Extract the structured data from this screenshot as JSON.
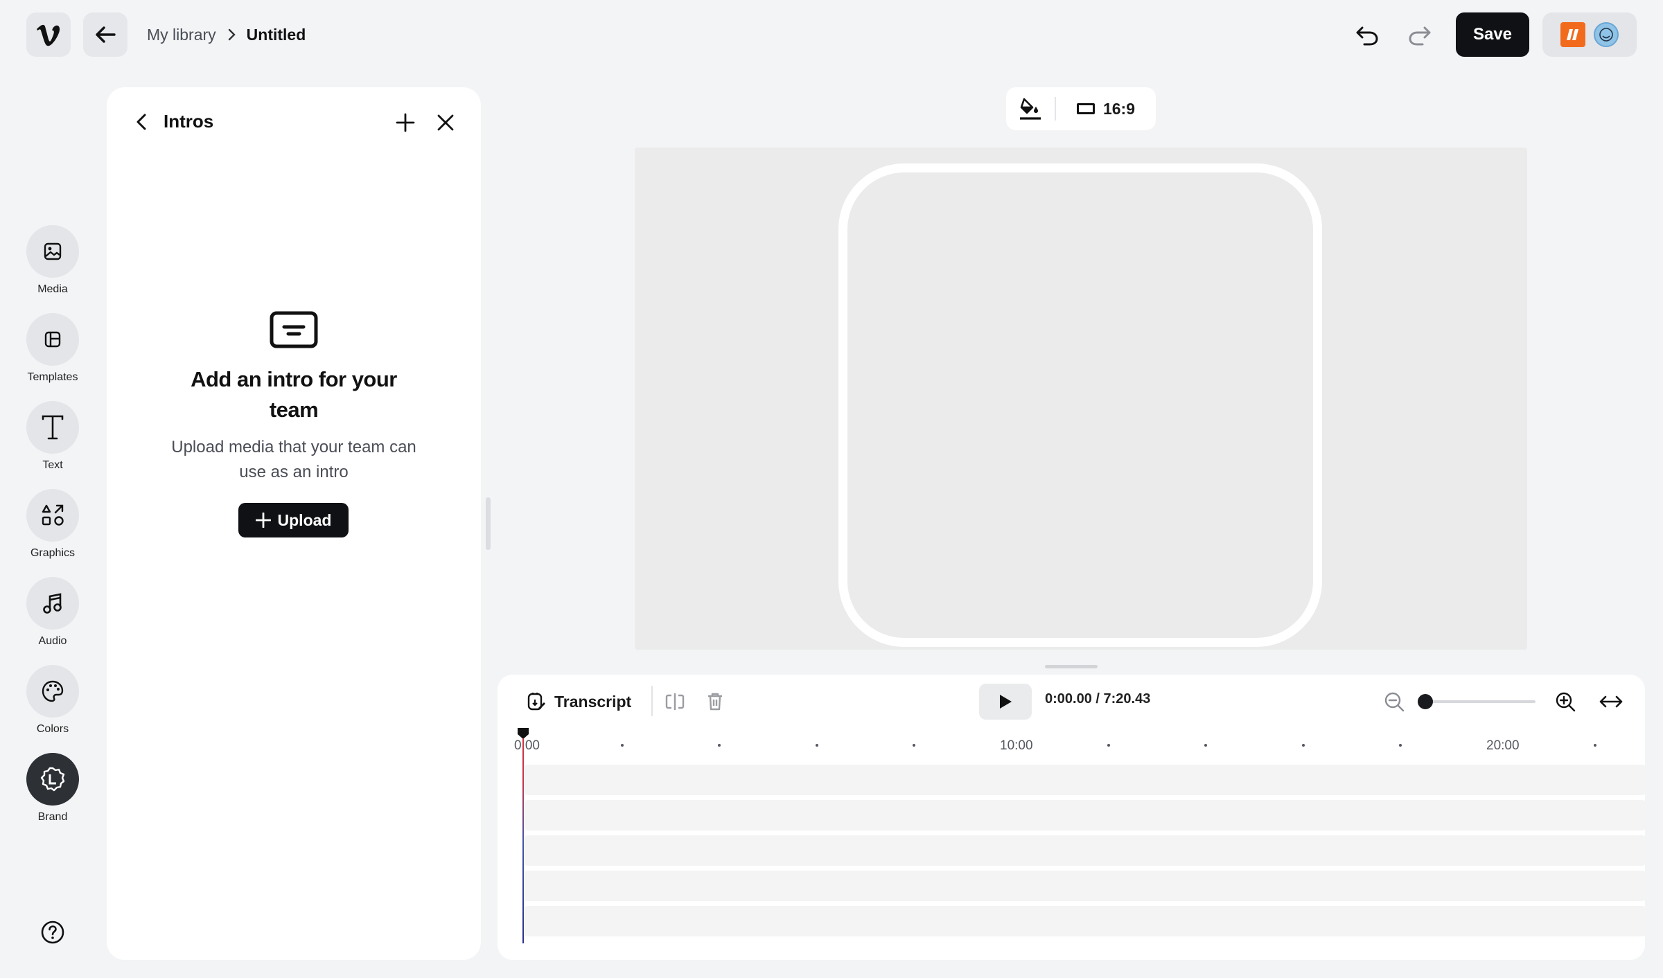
{
  "header": {
    "breadcrumb_library": "My library",
    "breadcrumb_current": "Untitled",
    "save_label": "Save"
  },
  "rail": {
    "items": [
      {
        "label": "Media",
        "icon": "image-icon"
      },
      {
        "label": "Templates",
        "icon": "layout-icon"
      },
      {
        "label": "Text",
        "icon": "text-icon"
      },
      {
        "label": "Graphics",
        "icon": "shapes-icon"
      },
      {
        "label": "Audio",
        "icon": "music-note-icon"
      },
      {
        "label": "Colors",
        "icon": "palette-icon"
      },
      {
        "label": "Brand",
        "icon": "brand-badge-icon"
      }
    ]
  },
  "panel": {
    "title": "Intros",
    "empty_title": "Add an intro for your team",
    "empty_description": "Upload media that your team can use as an intro",
    "upload_label": "Upload"
  },
  "canvas_toolbar": {
    "aspect_ratio": "16:9"
  },
  "timeline": {
    "transcript_label": "Transcript",
    "time_display": "0:00.00 / 7:20.43",
    "ruler_labels": [
      "0:00",
      "10:00",
      "20:00"
    ],
    "zoom_level": 0.0
  },
  "colors": {
    "accent_dark": "#0f1114",
    "workspace_badge": "#f26b1d",
    "canvas_bg": "#ebebeb"
  }
}
